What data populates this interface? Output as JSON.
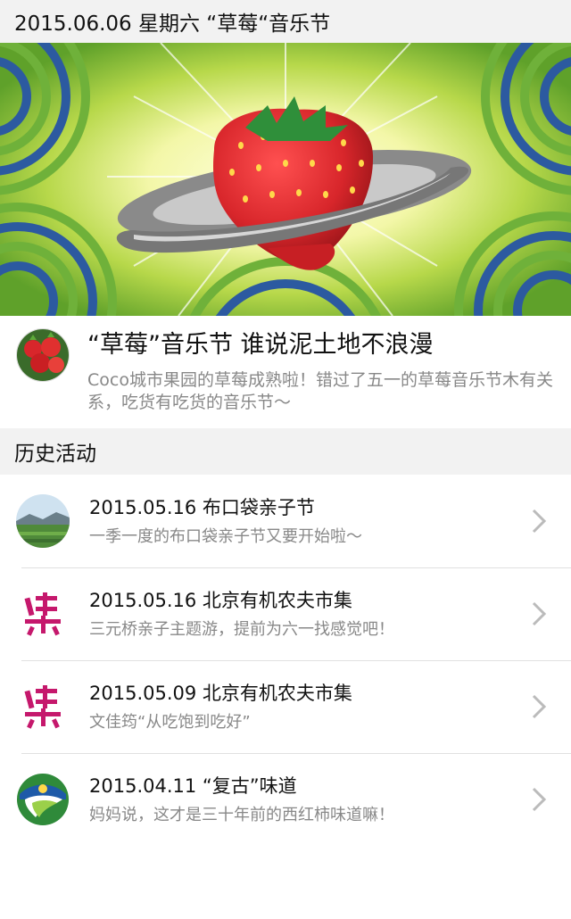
{
  "header": {
    "title": "2015.06.06 星期六 “草莓“音乐节"
  },
  "featured": {
    "title": "“草莓”音乐节  谁说泥土地不浪漫",
    "description": "Coco城市果园的草莓成熟啦！错过了五一的草莓音乐节木有关系，吃货有吃货的音乐节～"
  },
  "history": {
    "section_title": "历史活动",
    "items": [
      {
        "title": "2015.05.16 布口袋亲子节",
        "desc": "一季一度的布口袋亲子节又要开始啦～",
        "icon": "landscape-icon"
      },
      {
        "title": "2015.05.16 北京有机农夫市集",
        "desc": "三元桥亲子主题游，提前为六一找感觉吧！",
        "icon": "jiamu-logo-icon"
      },
      {
        "title": "2015.05.09 北京有机农夫市集",
        "desc": "文佳筠“从吃饱到吃好”",
        "icon": "jiamu-logo-icon"
      },
      {
        "title": "2015.04.11 “复古”味道",
        "desc": "妈妈说，这才是三十年前的西红柿味道嘛！",
        "icon": "farm-logo-icon"
      }
    ]
  },
  "colors": {
    "header_bg": "#f2f2f2",
    "hero_green": "#7dbb3a",
    "hero_blue": "#2c5aa0",
    "strawberry_red": "#d8262b",
    "logo_magenta": "#c5186c",
    "chevron": "#bbbbbb"
  }
}
